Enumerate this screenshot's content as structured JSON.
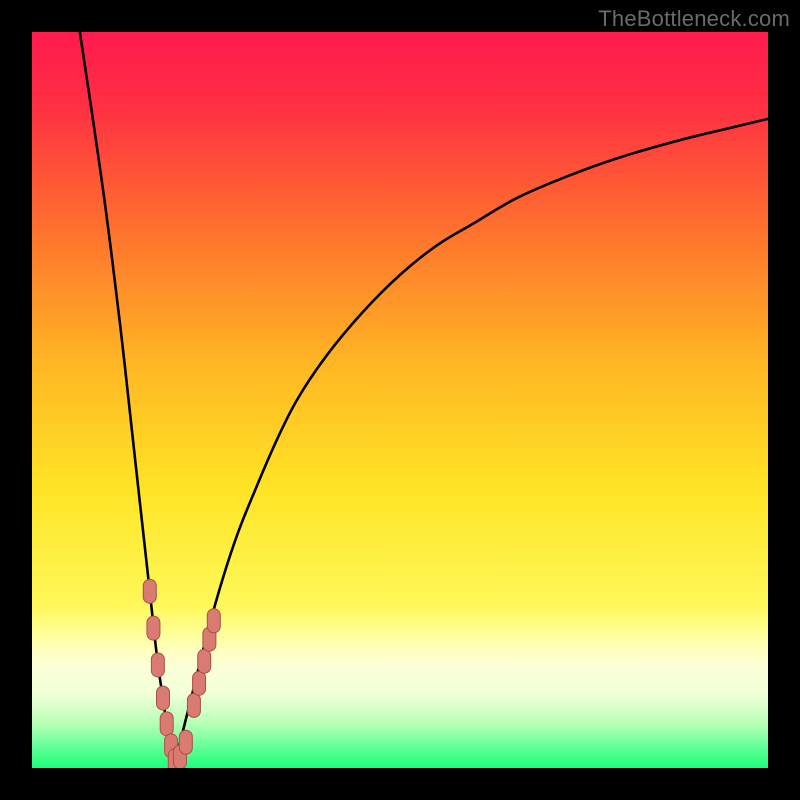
{
  "watermark": {
    "text": "TheBottleneck.com"
  },
  "colors": {
    "black": "#000000",
    "curve": "#000000",
    "marker_fill": "#d97b73",
    "marker_stroke": "#a84f47",
    "gradient_stops": [
      {
        "offset": 0.0,
        "color": "#ff1a4f"
      },
      {
        "offset": 0.1,
        "color": "#ff2f44"
      },
      {
        "offset": 0.25,
        "color": "#ff6a2f"
      },
      {
        "offset": 0.45,
        "color": "#ffb624"
      },
      {
        "offset": 0.62,
        "color": "#ffe425"
      },
      {
        "offset": 0.78,
        "color": "#fff85a"
      },
      {
        "offset": 0.82,
        "color": "#ffff9e"
      },
      {
        "offset": 0.86,
        "color": "#fdffd8"
      },
      {
        "offset": 0.9,
        "color": "#f0ffd8"
      },
      {
        "offset": 0.94,
        "color": "#b6ffb6"
      },
      {
        "offset": 0.97,
        "color": "#66ff99"
      },
      {
        "offset": 1.0,
        "color": "#1bff79"
      }
    ]
  },
  "chart_data": {
    "type": "line",
    "title": "",
    "xlabel": "",
    "ylabel": "",
    "xlim": [
      0,
      100
    ],
    "ylim": [
      0,
      100
    ],
    "grid": false,
    "legend": false,
    "description": "Bottleneck-style V-shaped curve. Steep descending branch from top-left reaching ~0 near x≈19, then a rising concave branch approaching ~88 at x=100.",
    "series": [
      {
        "name": "left-branch",
        "x": [
          6.5,
          8,
          10,
          12,
          14,
          15,
          16,
          17,
          18,
          18.7,
          19.3
        ],
        "values": [
          100,
          90,
          76,
          60,
          42,
          33,
          24,
          15,
          8,
          3,
          0.5
        ]
      },
      {
        "name": "right-branch",
        "x": [
          19.3,
          20,
          21,
          22,
          24,
          26,
          28,
          30,
          33,
          36,
          40,
          45,
          50,
          55,
          60,
          66,
          73,
          80,
          88,
          95,
          100
        ],
        "values": [
          0.5,
          3,
          7,
          11,
          19,
          26,
          32,
          37,
          44,
          50,
          56,
          62,
          67,
          71,
          74,
          77.5,
          80.5,
          83,
          85.3,
          87,
          88.2
        ]
      }
    ],
    "markers": {
      "name": "highlighted-points",
      "shape": "rounded-pill",
      "x": [
        16.0,
        16.5,
        17.1,
        17.8,
        18.3,
        18.9,
        19.4,
        20.1,
        20.9,
        22.0,
        22.7,
        23.4,
        24.1,
        24.7
      ],
      "values": [
        24.0,
        19.0,
        14.0,
        9.5,
        6.0,
        3.0,
        1.0,
        1.5,
        3.5,
        8.5,
        11.5,
        14.5,
        17.5,
        20.0
      ]
    }
  }
}
